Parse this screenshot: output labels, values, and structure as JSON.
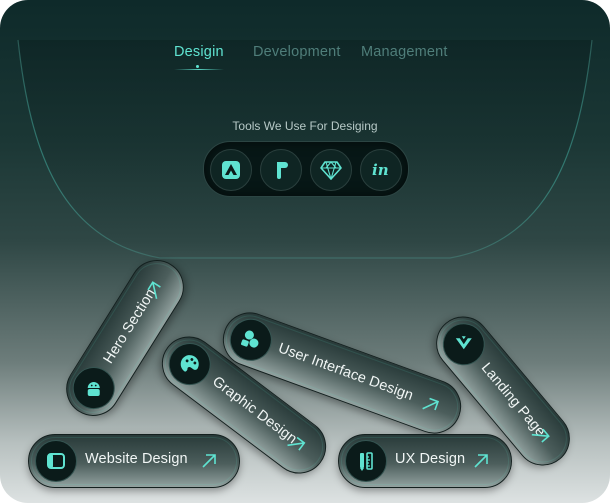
{
  "tabs": [
    {
      "label": "Desigin",
      "active": true
    },
    {
      "label": "Development",
      "active": false
    },
    {
      "label": "Management",
      "active": false
    }
  ],
  "tools": {
    "title": "Tools We Use For Desiging",
    "icons": [
      "adobe-xd-icon",
      "figma-icon",
      "sketch-icon",
      "invision-icon"
    ]
  },
  "services": [
    {
      "label": "Hero Section",
      "icon": "android-icon"
    },
    {
      "label": "Graphic Design",
      "icon": "palette-icon"
    },
    {
      "label": "User Interface Design",
      "icon": "ui-shapes-icon"
    },
    {
      "label": "Landing Page",
      "icon": "ui-icon"
    },
    {
      "label": "Website Design",
      "icon": "browser-icon"
    },
    {
      "label": "UX Design",
      "icon": "pencil-ruler-icon"
    }
  ],
  "colors": {
    "accent": "#5fe3d1",
    "tab_inactive": "#4f7e7a",
    "card_top": "#0e2a2a",
    "card_bottom": "#dde2e2",
    "pill_text": "#f1f6f5"
  }
}
